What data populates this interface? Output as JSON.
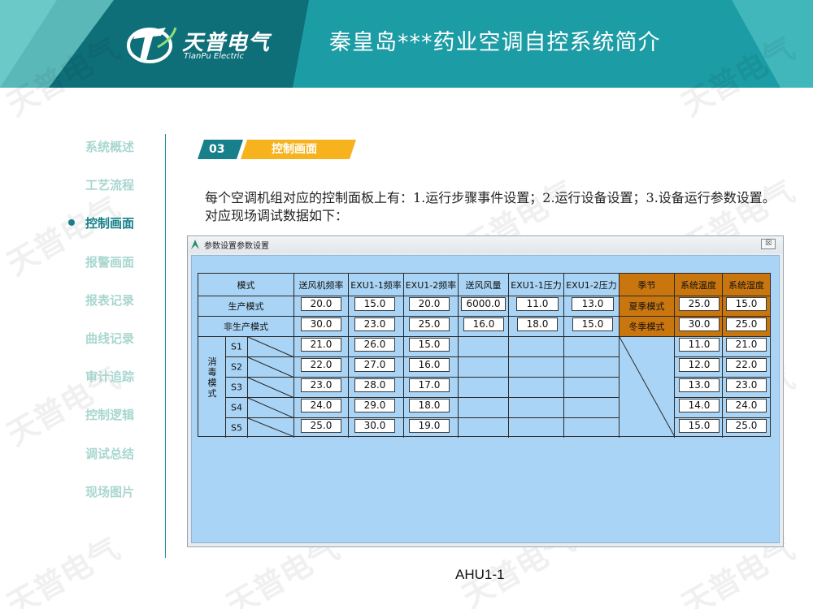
{
  "header": {
    "logo_cn": "天普电气",
    "logo_en": "TianPu Electric",
    "title": "秦皇岛***药业空调自控系统简介",
    "colors": {
      "teal_dark": "#0d6f78",
      "teal": "#1c9ca4",
      "teal_light": "#5cc1c4"
    }
  },
  "sidebar": {
    "items": [
      {
        "label": "系统概述",
        "active": false
      },
      {
        "label": "工艺流程",
        "active": false
      },
      {
        "label": "控制画面",
        "active": true
      },
      {
        "label": "报警画面",
        "active": false
      },
      {
        "label": "报表记录",
        "active": false
      },
      {
        "label": "曲线记录",
        "active": false
      },
      {
        "label": "审计追踪",
        "active": false
      },
      {
        "label": "控制逻辑",
        "active": false
      },
      {
        "label": "调试总结",
        "active": false
      },
      {
        "label": "现场图片",
        "active": false
      }
    ]
  },
  "section": {
    "number": "03",
    "title": "控制画面"
  },
  "intro": "每个空调机组对应的控制面板上有：1.运行步骤事件设置；2.运行设备设置；3.设备运行参数设置。对应现场调试数据如下：",
  "dialog": {
    "title": "参数设置参数设置",
    "close_label": "☒",
    "table": {
      "mode_header": "模式",
      "headers": [
        "送风机频率",
        "EXU1-1频率",
        "EXU1-2频率",
        "送风风量",
        "EXU1-1压力",
        "EXU1-2压力"
      ],
      "season_header": "季节",
      "temp_header": "系统温度",
      "humid_header": "系统湿度",
      "rows": [
        {
          "label": "生产模式",
          "values": [
            "20.0",
            "15.0",
            "20.0",
            "6000.0",
            "11.0",
            "13.0"
          ],
          "season": "夏季模式",
          "temp": "25.0",
          "humid": "15.0"
        },
        {
          "label": "非生产模式",
          "values": [
            "30.0",
            "23.0",
            "25.0",
            "16.0",
            "18.0",
            "15.0"
          ],
          "season": "冬季模式",
          "temp": "30.0",
          "humid": "25.0"
        }
      ],
      "disinfect_label": "消毒模式",
      "disinfect_rows": [
        {
          "label": "S1",
          "values": [
            "21.0",
            "26.0",
            "15.0"
          ],
          "temp": "11.0",
          "humid": "21.0"
        },
        {
          "label": "S2",
          "values": [
            "22.0",
            "27.0",
            "16.0"
          ],
          "temp": "12.0",
          "humid": "22.0"
        },
        {
          "label": "S3",
          "values": [
            "23.0",
            "28.0",
            "17.0"
          ],
          "temp": "13.0",
          "humid": "23.0"
        },
        {
          "label": "S4",
          "values": [
            "24.0",
            "29.0",
            "18.0"
          ],
          "temp": "14.0",
          "humid": "24.0"
        },
        {
          "label": "S5",
          "values": [
            "25.0",
            "30.0",
            "19.0"
          ],
          "temp": "15.0",
          "humid": "25.0"
        }
      ]
    }
  },
  "footer": "AHU1-1",
  "watermark": "天普电气"
}
